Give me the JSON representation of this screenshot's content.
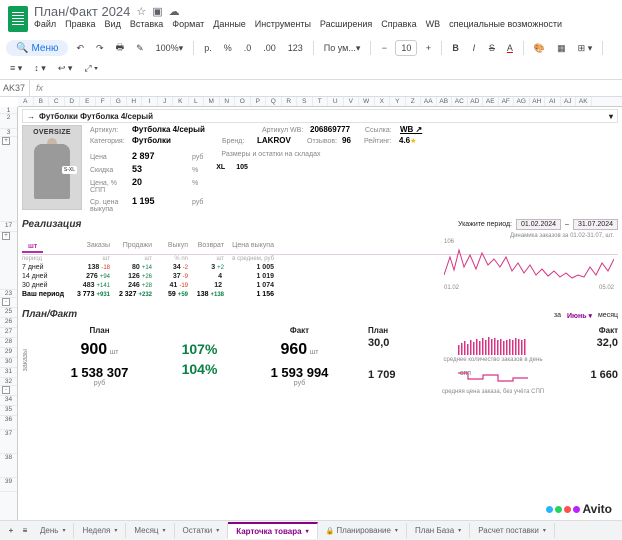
{
  "doc_title": "План/Факт 2024",
  "menu": {
    "file": "Файл",
    "edit": "Правка",
    "view": "Вид",
    "insert": "Вставка",
    "format": "Формат",
    "data": "Данные",
    "tools": "Инструменты",
    "ext": "Расширения",
    "help": "Справка",
    "wb": "WB",
    "acc": "специальные возможности"
  },
  "toolbar": {
    "menu": "Меню",
    "zoom": "100%",
    "currency": "р.",
    "pct": "%",
    "dec1": ".0",
    "dec2": ".00",
    "num": "123",
    "font": "По ум...",
    "fontsize": "10"
  },
  "cell_ref": "AK37",
  "fx": "fx",
  "cols": [
    "A",
    "B",
    "C",
    "D",
    "E",
    "F",
    "G",
    "H",
    "I",
    "J",
    "K",
    "L",
    "M",
    "N",
    "O",
    "P",
    "Q",
    "R",
    "S",
    "T",
    "U",
    "V",
    "W",
    "X",
    "Y",
    "Z",
    "AA",
    "AB",
    "AC",
    "AD",
    "AE",
    "AF",
    "AG",
    "AH",
    "AI",
    "AJ",
    "AK"
  ],
  "crumb": {
    "arrow": "→",
    "text": "Футболки Футболка 4/серый"
  },
  "product": {
    "overlay": "OVERSIZE",
    "size_badge": "S-XL",
    "art_lbl": "Артикул:",
    "art": "Футболка 4/серый",
    "artwb_lbl": "Артикул WB:",
    "artwb": "206869777",
    "link_lbl": "Ссылка:",
    "link": "WB ↗",
    "cat_lbl": "Категория:",
    "cat": "Футболки",
    "brand_lbl": "Бренд:",
    "brand": "LAKROV",
    "rev_lbl": "Отзывов:",
    "rev": "96",
    "rate_lbl": "Рейтинг:",
    "rate": "4.6",
    "price_lbl": "Цена",
    "price": "2 897",
    "price_u": "руб",
    "sizes_lbl": "Размеры и остатки на складах",
    "sizes": "XL",
    "disc_lbl": "Скидка",
    "disc": "53",
    "disc_u": "%",
    "stock": "105",
    "spp_lbl": "Цена, % СПП",
    "spp": "20",
    "spp_u": "%",
    "avg_lbl": "Ср. цена выкупа",
    "avg": "1 195",
    "avg_u": "руб"
  },
  "realiz": {
    "title": "Реализация",
    "period_lbl": "Укажите период:",
    "from": "01.02.2024",
    "dash": "–",
    "to": "31.07.2024",
    "tab": "шт",
    "hdr": {
      "per": "период",
      "ord": "Заказы",
      "sal": "Продажи",
      "buy": "Выкуп",
      "ret": "Возврат",
      "avg": "Цена выкупа"
    },
    "units": {
      "ord": "шт",
      "sal": "шт",
      "buy": "% nn",
      "ret": "шт",
      "avg": "в среднем, руб"
    },
    "rows": [
      {
        "per": "7 дней",
        "ord": "138",
        "ord_d": "-18",
        "sal": "80",
        "sal_d": "+14",
        "buy": "34",
        "buy_d": "-2",
        "ret": "3",
        "ret_d": "+2",
        "avg": "1 005"
      },
      {
        "per": "14 дней",
        "ord": "276",
        "ord_d": "+94",
        "sal": "126",
        "sal_d": "+26",
        "buy": "37",
        "buy_d": "-9",
        "ret": "4",
        "ret_d": "",
        "avg": "1 019"
      },
      {
        "per": "30 дней",
        "ord": "483",
        "ord_d": "+141",
        "sal": "246",
        "sal_d": "+28",
        "buy": "41",
        "buy_d": "-19",
        "ret": "12",
        "ret_d": "",
        "avg": "1 074"
      },
      {
        "per": "Ваш период",
        "ord": "3 773",
        "ord_d": "+931",
        "sal": "2 327",
        "sal_d": "+232",
        "buy": "59",
        "buy_d": "+59",
        "ret": "138",
        "ret_d": "+138",
        "avg": "1 156"
      }
    ],
    "spark_title": "Динамика заказов за 01.02-31.07, шт.",
    "spark_max": "106",
    "spark_from": "01.02",
    "spark_to": "05.02"
  },
  "pf": {
    "title": "План/Факт",
    "za": "за",
    "month": "Июнь",
    "mlabel": "месяц",
    "plan_h": "План",
    "fact_h": "Факт",
    "plan_qty": "900",
    "pct1": "107%",
    "fact_qty": "960",
    "unit_qty": "шт",
    "plan_sum": "1 538 307",
    "pct2": "104%",
    "fact_sum": "1 593 994",
    "unit_sum": "руб",
    "side": "заказы",
    "r_plan": "30,0",
    "r_fact": "32,0",
    "r_sub1": "среднее количество заказов в день",
    "r_plan2": "1 709",
    "r_fact2": "1 660",
    "r_sub2": "средняя цена заказа, без учёта СПП",
    "spp_tag": "СПП"
  },
  "tabs": {
    "t1": "День",
    "t2": "Неделя",
    "t3": "Месяц",
    "t4": "Остатки",
    "t5": "Карточка товара",
    "t6": "Планирование",
    "t7": "План База",
    "t8": "Расчет поставки"
  },
  "watermark": "Avito",
  "chart_data": [
    {
      "type": "line",
      "title": "Динамика заказов за 01.02-31.07, шт.",
      "x_range": [
        "01.02",
        "31.07"
      ],
      "ylim": [
        0,
        106
      ],
      "values": [
        10,
        35,
        20,
        60,
        25,
        45,
        20,
        55,
        30,
        40,
        22,
        48,
        18,
        30,
        15,
        30,
        12,
        25,
        10,
        20,
        8,
        18,
        6,
        15,
        10,
        28,
        14,
        32,
        20,
        40
      ]
    },
    {
      "type": "bar",
      "title": "среднее количество заказов в день",
      "categories_note": "дни месяца",
      "values": [
        24,
        26,
        28,
        25,
        30,
        27,
        31,
        29,
        32,
        30,
        33,
        31,
        34,
        32,
        33,
        31,
        30,
        32,
        31,
        33,
        30,
        32,
        31,
        34,
        32,
        33,
        31,
        32,
        30,
        32
      ]
    },
    {
      "type": "line",
      "title": "средняя цена заказа, без учёта СПП",
      "ylim": [
        1600,
        1750
      ],
      "values": [
        1700,
        1710,
        1690,
        1720,
        1680,
        1700,
        1660,
        1680,
        1670,
        1690,
        1660,
        1680,
        1665,
        1670,
        1660,
        1665,
        1660,
        1662,
        1660,
        1661
      ]
    }
  ]
}
